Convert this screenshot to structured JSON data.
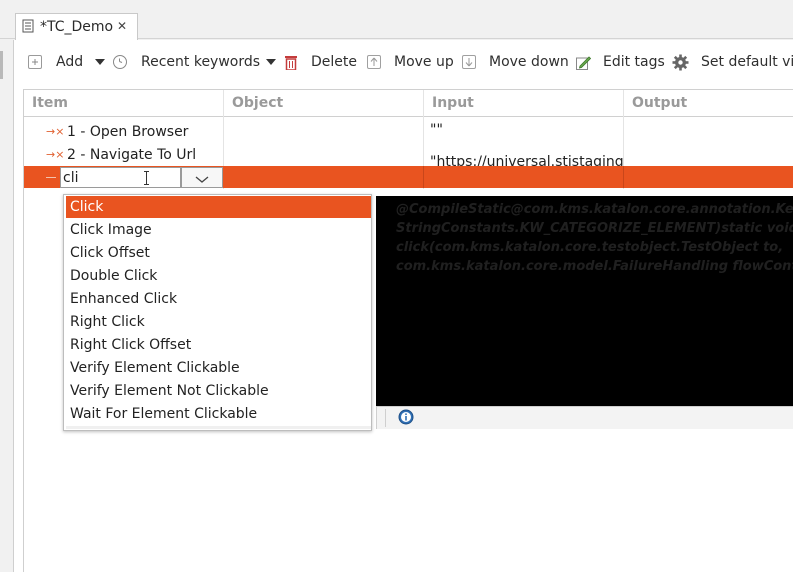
{
  "tab": {
    "title": "*TC_Demo"
  },
  "toolbar": {
    "add": "Add",
    "recent": "Recent keywords",
    "delete": "Delete",
    "move_up": "Move up",
    "move_down": "Move down",
    "edit_tags": "Edit tags",
    "set_default": "Set default vie"
  },
  "grid": {
    "columns": [
      "Item",
      "Object",
      "Input",
      "Output"
    ],
    "rows": [
      {
        "item": "1 - Open Browser",
        "input": "\"\""
      },
      {
        "item": "2 - Navigate To Url",
        "input": "\"https://universal.stistaging."
      }
    ],
    "editor_value": "cli"
  },
  "autocomplete": {
    "items": [
      "Click",
      "Click Image",
      "Click Offset",
      "Double Click",
      "Enhanced Click",
      "Right Click",
      "Right Click Offset",
      "Verify Element Clickable",
      "Verify Element Not Clickable",
      "Wait For Element Clickable"
    ],
    "selected_index": 0
  },
  "doc": {
    "lines": [
      "@CompileStatic@com.kms.katalon.core.annotation.Keywo",
      "StringConstants.KW_CATEGORIZE_ELEMENT)static void",
      "click(com.kms.katalon.core.testobject.TestObject to,",
      "com.kms.katalon.core.model.FailureHandling flowControl"
    ]
  },
  "colors": {
    "accent": "#e95420"
  }
}
